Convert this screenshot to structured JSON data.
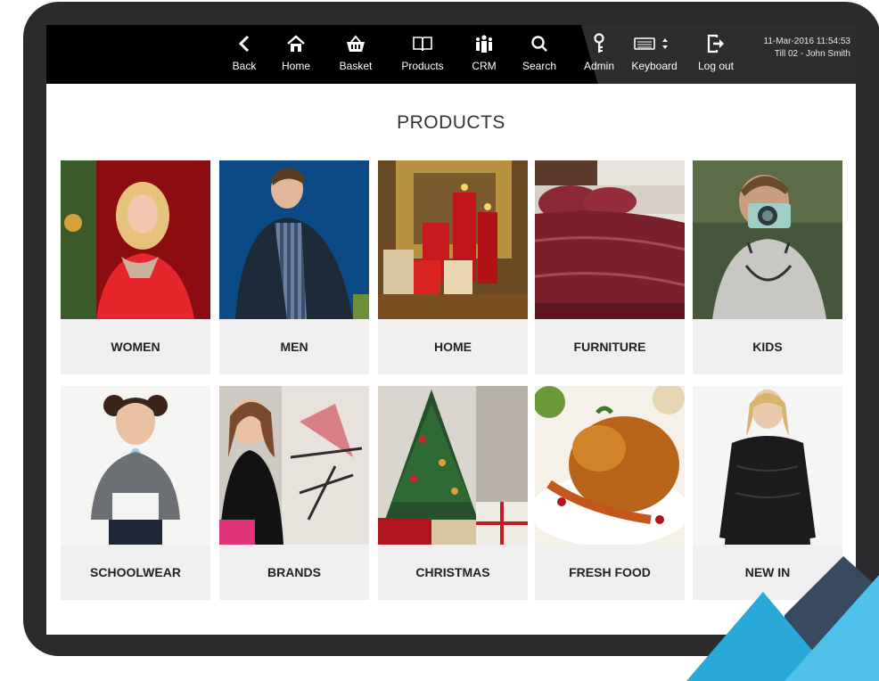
{
  "nav": [
    {
      "label": "Back",
      "icon": "back-icon"
    },
    {
      "label": "Home",
      "icon": "home-icon"
    },
    {
      "label": "Basket",
      "icon": "basket-icon"
    },
    {
      "label": "Products",
      "icon": "book-icon"
    },
    {
      "label": "CRM",
      "icon": "people-icon"
    },
    {
      "label": "Search",
      "icon": "search-icon"
    },
    {
      "label": "Admin",
      "icon": "key-icon"
    },
    {
      "label": "Keyboard",
      "icon": "keyboard-icon"
    },
    {
      "label": "Log out",
      "icon": "logout-icon"
    }
  ],
  "session": {
    "datetime": "11-Mar-2016 11:54:53",
    "till": "Till 02 - John Smith"
  },
  "page_title": "PRODUCTS",
  "categories": [
    {
      "label": "WOMEN"
    },
    {
      "label": "MEN"
    },
    {
      "label": "HOME"
    },
    {
      "label": "FURNITURE"
    },
    {
      "label": "KIDS"
    },
    {
      "label": "SCHOOLWEAR"
    },
    {
      "label": "BRANDS"
    },
    {
      "label": "CHRISTMAS"
    },
    {
      "label": "FRESH FOOD"
    },
    {
      "label": "NEW IN"
    }
  ],
  "colors": {
    "topbar": "#000000",
    "admin_panel": "#2d2d2d",
    "tile_bg": "#efefef",
    "frame": "#2b2b2d",
    "accent_blue": "#29a9d8",
    "accent_navy": "#374a60"
  }
}
